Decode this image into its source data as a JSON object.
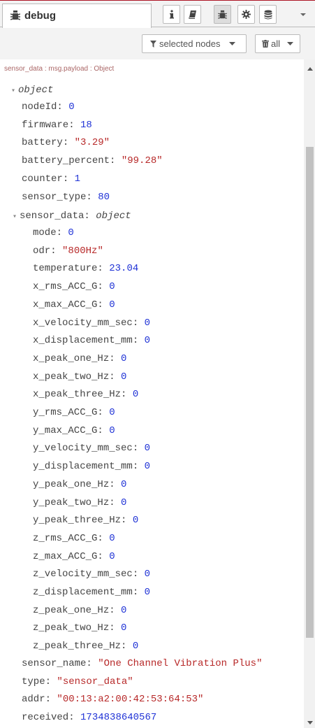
{
  "tab": {
    "title": "debug",
    "icon": "bug-icon"
  },
  "toolbar": {
    "buttons": [
      {
        "name": "info-button",
        "icon": "info-icon"
      },
      {
        "name": "help-button",
        "icon": "book-icon"
      },
      {
        "name": "debug-button",
        "icon": "bug-icon"
      },
      {
        "name": "config-button",
        "icon": "gear-icon"
      },
      {
        "name": "context-button",
        "icon": "database-icon"
      }
    ],
    "dropdown_icon": "caret-down-icon"
  },
  "filters": {
    "nodes_label": "selected nodes",
    "clear_label": "all"
  },
  "message": {
    "meta": "sensor_data : msg.payload : Object",
    "root_label": "object",
    "fields": [
      {
        "key": "nodeId",
        "value": "0",
        "kind": "num"
      },
      {
        "key": "firmware",
        "value": "18",
        "kind": "num"
      },
      {
        "key": "battery",
        "value": "\"3.29\"",
        "kind": "str"
      },
      {
        "key": "battery_percent",
        "value": "\"99.28\"",
        "kind": "str"
      },
      {
        "key": "counter",
        "value": "1",
        "kind": "num"
      },
      {
        "key": "sensor_type",
        "value": "80",
        "kind": "num"
      }
    ],
    "sensor_data": {
      "key": "sensor_data",
      "type": "object",
      "fields": [
        {
          "key": "mode",
          "value": "0",
          "kind": "num"
        },
        {
          "key": "odr",
          "value": "\"800Hz\"",
          "kind": "str"
        },
        {
          "key": "temperature",
          "value": "23.04",
          "kind": "num"
        },
        {
          "key": "x_rms_ACC_G",
          "value": "0",
          "kind": "num"
        },
        {
          "key": "x_max_ACC_G",
          "value": "0",
          "kind": "num"
        },
        {
          "key": "x_velocity_mm_sec",
          "value": "0",
          "kind": "num"
        },
        {
          "key": "x_displacement_mm",
          "value": "0",
          "kind": "num"
        },
        {
          "key": "x_peak_one_Hz",
          "value": "0",
          "kind": "num"
        },
        {
          "key": "x_peak_two_Hz",
          "value": "0",
          "kind": "num"
        },
        {
          "key": "x_peak_three_Hz",
          "value": "0",
          "kind": "num"
        },
        {
          "key": "y_rms_ACC_G",
          "value": "0",
          "kind": "num"
        },
        {
          "key": "y_max_ACC_G",
          "value": "0",
          "kind": "num"
        },
        {
          "key": "y_velocity_mm_sec",
          "value": "0",
          "kind": "num"
        },
        {
          "key": "y_displacement_mm",
          "value": "0",
          "kind": "num"
        },
        {
          "key": "y_peak_one_Hz",
          "value": "0",
          "kind": "num"
        },
        {
          "key": "y_peak_two_Hz",
          "value": "0",
          "kind": "num"
        },
        {
          "key": "y_peak_three_Hz",
          "value": "0",
          "kind": "num"
        },
        {
          "key": "z_rms_ACC_G",
          "value": "0",
          "kind": "num"
        },
        {
          "key": "z_max_ACC_G",
          "value": "0",
          "kind": "num"
        },
        {
          "key": "z_velocity_mm_sec",
          "value": "0",
          "kind": "num"
        },
        {
          "key": "z_displacement_mm",
          "value": "0",
          "kind": "num"
        },
        {
          "key": "z_peak_one_Hz",
          "value": "0",
          "kind": "num"
        },
        {
          "key": "z_peak_two_Hz",
          "value": "0",
          "kind": "num"
        },
        {
          "key": "z_peak_three_Hz",
          "value": "0",
          "kind": "num"
        }
      ]
    },
    "trailing_fields": [
      {
        "key": "sensor_name",
        "value": "\"One Channel Vibration Plus\"",
        "kind": "str"
      },
      {
        "key": "type",
        "value": "\"sensor_data\"",
        "kind": "str"
      },
      {
        "key": "addr",
        "value": "\"00:13:a2:00:42:53:64:53\"",
        "kind": "str"
      },
      {
        "key": "received",
        "value": "1734838640567",
        "kind": "num"
      }
    ]
  },
  "colors": {
    "number": "#2033d6",
    "string": "#b72828",
    "meta": "#aa6666",
    "accent": "#ad1625"
  }
}
